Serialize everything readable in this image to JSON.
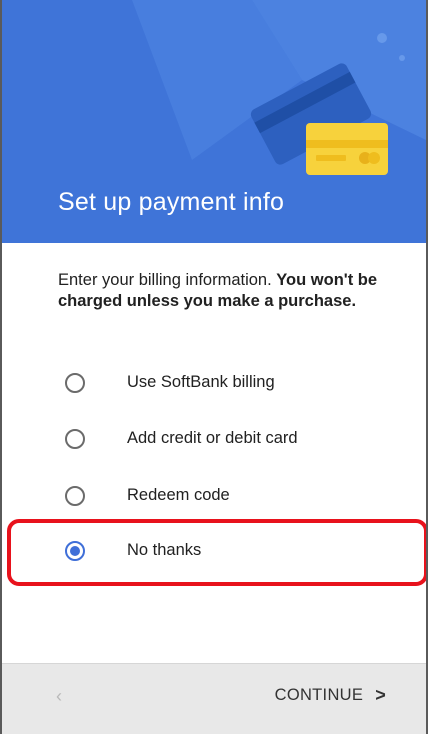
{
  "header": {
    "title": "Set up payment info"
  },
  "intro": {
    "text": "Enter your billing information. ",
    "bold": "You won't be charged unless you make a purchase."
  },
  "options": [
    {
      "label": "Use SoftBank billing",
      "selected": false
    },
    {
      "label": "Add credit or debit card",
      "selected": false
    },
    {
      "label": "Redeem code",
      "selected": false
    },
    {
      "label": "No thanks",
      "selected": true
    }
  ],
  "footer": {
    "back_icon": "‹",
    "continue_label": "CONTINUE",
    "continue_icon": ">"
  },
  "colors": {
    "header_blue": "#3f74d8",
    "accent": "#3f6fd8",
    "highlight": "#e8121c",
    "card_yellow": "#f7d23c"
  }
}
